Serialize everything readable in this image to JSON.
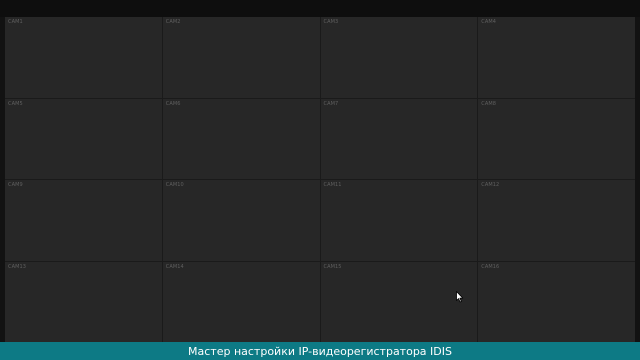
{
  "grid": {
    "cells": [
      {
        "label": "CAM1"
      },
      {
        "label": "CAM2"
      },
      {
        "label": "CAM3"
      },
      {
        "label": "CAM4"
      },
      {
        "label": "CAM5"
      },
      {
        "label": "CAM6"
      },
      {
        "label": "CAM7"
      },
      {
        "label": "CAM8"
      },
      {
        "label": "CAM9"
      },
      {
        "label": "CAM10"
      },
      {
        "label": "CAM11"
      },
      {
        "label": "CAM12"
      },
      {
        "label": "CAM13"
      },
      {
        "label": "CAM14"
      },
      {
        "label": "CAM15"
      },
      {
        "label": "CAM16"
      }
    ]
  },
  "caption": {
    "text": "Мастер настройки IP-видеорегистратора IDIS"
  },
  "colors": {
    "background": "#121212",
    "cell_background": "#272727",
    "cell_label": "#5f5f5f",
    "caption_background": "#0d7a85",
    "caption_text": "#ffffff"
  },
  "icons": {
    "cursor": "mouse-pointer-icon"
  }
}
